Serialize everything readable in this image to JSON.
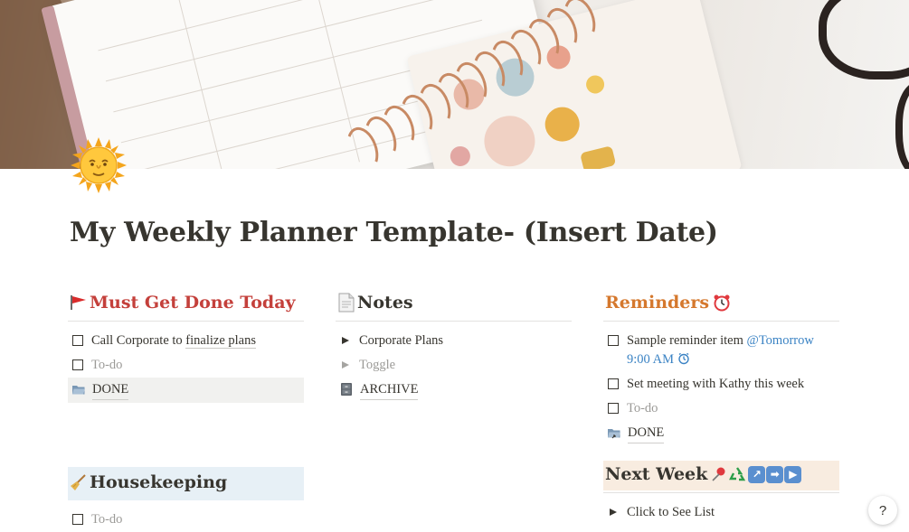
{
  "page": {
    "title": "My Weekly Planner Template- (Insert Date)",
    "icon": "sun-with-face-icon"
  },
  "must_get_done": {
    "heading": "Must Get Done Today",
    "heading_icon": "red-flag-icon",
    "items": [
      {
        "text_before": "Call Corporate to ",
        "link_text": "finalize plans",
        "checked": false
      },
      {
        "text": "To-do",
        "placeholder": true,
        "checked": false
      }
    ],
    "done_page": "DONE"
  },
  "notes": {
    "heading": "Notes",
    "heading_icon": "page-icon",
    "toggles": [
      {
        "text": "Corporate Plans"
      },
      {
        "text": "Toggle",
        "placeholder": true
      }
    ],
    "archive_page": "ARCHIVE"
  },
  "reminders": {
    "heading": "Reminders",
    "heading_icon": "alarm-clock-icon",
    "items": [
      {
        "text": "Sample reminder item ",
        "mention": "@Tomorrow",
        "time": "9:00 AM"
      },
      {
        "text": "Set meeting with Kathy this week"
      },
      {
        "text": "To-do",
        "placeholder": true
      }
    ],
    "done_page": "DONE"
  },
  "housekeeping": {
    "heading": "Housekeeping",
    "heading_icon": "broom-icon",
    "items": [
      {
        "text": "To-do",
        "placeholder": true
      }
    ]
  },
  "next_week": {
    "heading": "Next Week",
    "heading_icons": [
      "pushpin-icon",
      "recycle-icon",
      "arrow-up-right-icon",
      "arrow-right-icon",
      "play-icon"
    ],
    "toggle": "Click to See List"
  },
  "help": {
    "label": "?"
  },
  "colors": {
    "red_heading": "#c4403b",
    "orange_heading": "#d5782d",
    "mention_blue": "#3b83c4",
    "housekeeping_bg": "#e7f0f6",
    "next_week_bg": "#f8ece0"
  }
}
